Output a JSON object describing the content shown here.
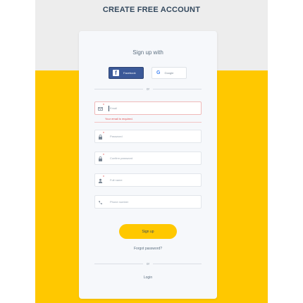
{
  "page": {
    "title": "CREATE FREE ACCOUNT"
  },
  "card": {
    "subtitle": "Sign up with",
    "facebook_label": "Facebook",
    "facebook_glyph": "f",
    "google_label": "Google",
    "google_glyph": "G",
    "or_text": "or",
    "fields": {
      "email": {
        "placeholder": "Email",
        "error": "Your email is required."
      },
      "password": {
        "placeholder": "Password"
      },
      "confirm_password": {
        "placeholder": "Confirm password"
      },
      "full_name": {
        "placeholder": "Full name"
      },
      "phone": {
        "placeholder": "Phone number"
      }
    },
    "required_mark": "*",
    "signup_label": "Sign up",
    "forgot_label": "Forgot password?",
    "or_text_2": "or",
    "login_label": "Login"
  },
  "colors": {
    "accent": "#ffc800",
    "facebook": "#3b5998",
    "error": "#e24c4c",
    "title": "#34495e"
  },
  "icons": [
    "facebook-icon",
    "google-icon",
    "email-icon",
    "lock-icon",
    "lock-icon",
    "user-icon",
    "phone-icon"
  ]
}
